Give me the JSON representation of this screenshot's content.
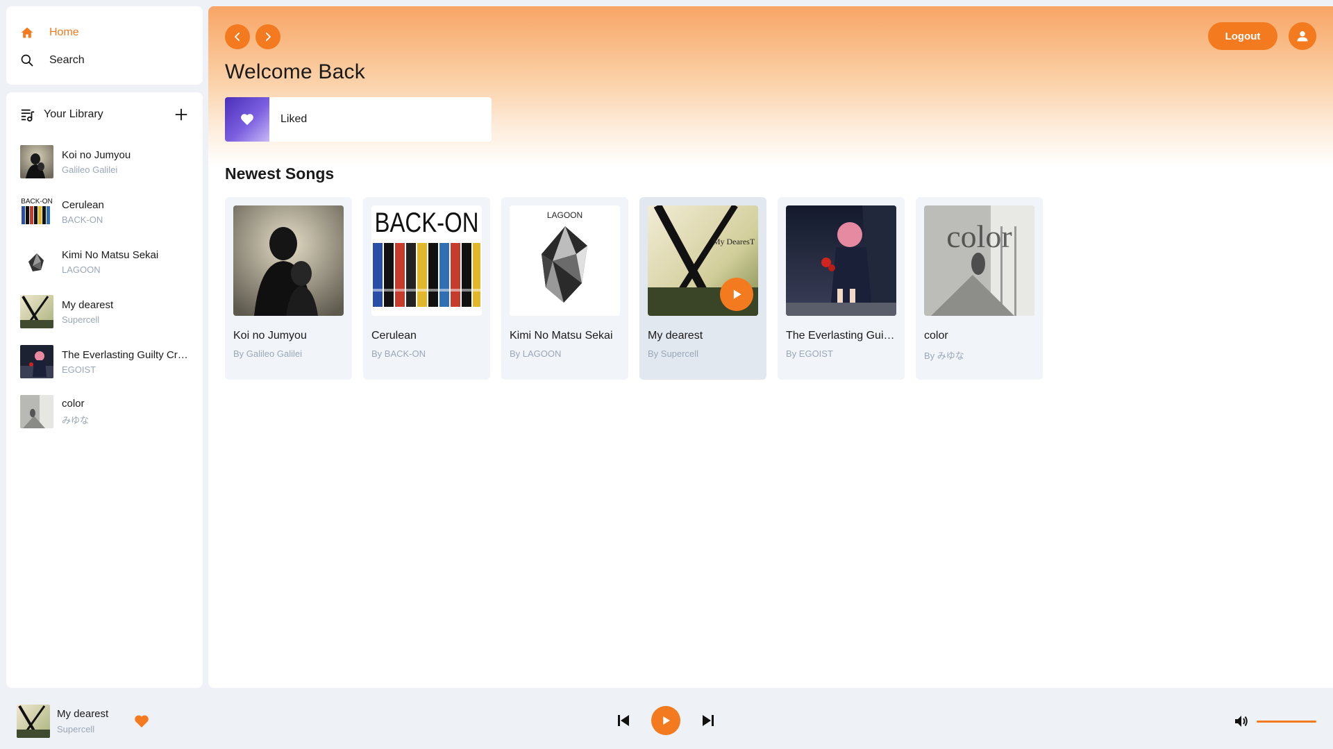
{
  "nav": {
    "home_label": "Home",
    "search_label": "Search"
  },
  "library": {
    "title": "Your Library",
    "items": [
      {
        "title": "Koi no Jumyou",
        "artist": "Galileo Galilei"
      },
      {
        "title": "Cerulean",
        "artist": "BACK-ON"
      },
      {
        "title": "Kimi No Matsu Sekai",
        "artist": "LAGOON"
      },
      {
        "title": "My dearest",
        "artist": "Supercell"
      },
      {
        "title": "The Everlasting Guilty Crown",
        "artist": "EGOIST"
      },
      {
        "title": "color",
        "artist": "みゆな"
      }
    ]
  },
  "header": {
    "logout_label": "Logout",
    "welcome": "Welcome Back",
    "liked_label": "Liked"
  },
  "newest": {
    "title": "Newest Songs",
    "songs": [
      {
        "title": "Koi no Jumyou",
        "artist": "By Galileo Galilei"
      },
      {
        "title": "Cerulean",
        "artist": "By BACK-ON",
        "art_text": "BACK-ON"
      },
      {
        "title": "Kimi No Matsu Sekai",
        "artist": "By LAGOON",
        "art_text": "LAGOON"
      },
      {
        "title": "My dearest",
        "artist": "By Supercell",
        "art_text": "My DearesT"
      },
      {
        "title": "The Everlasting Guilty Crown",
        "artist": "By EGOIST"
      },
      {
        "title": "color",
        "artist": "By みゆな",
        "art_text": "color"
      }
    ]
  },
  "player": {
    "title": "My dearest",
    "artist": "Supercell",
    "volume": 1.0
  },
  "colors": {
    "accent": "#f47a1f",
    "muted_text": "#9aa7b8"
  }
}
